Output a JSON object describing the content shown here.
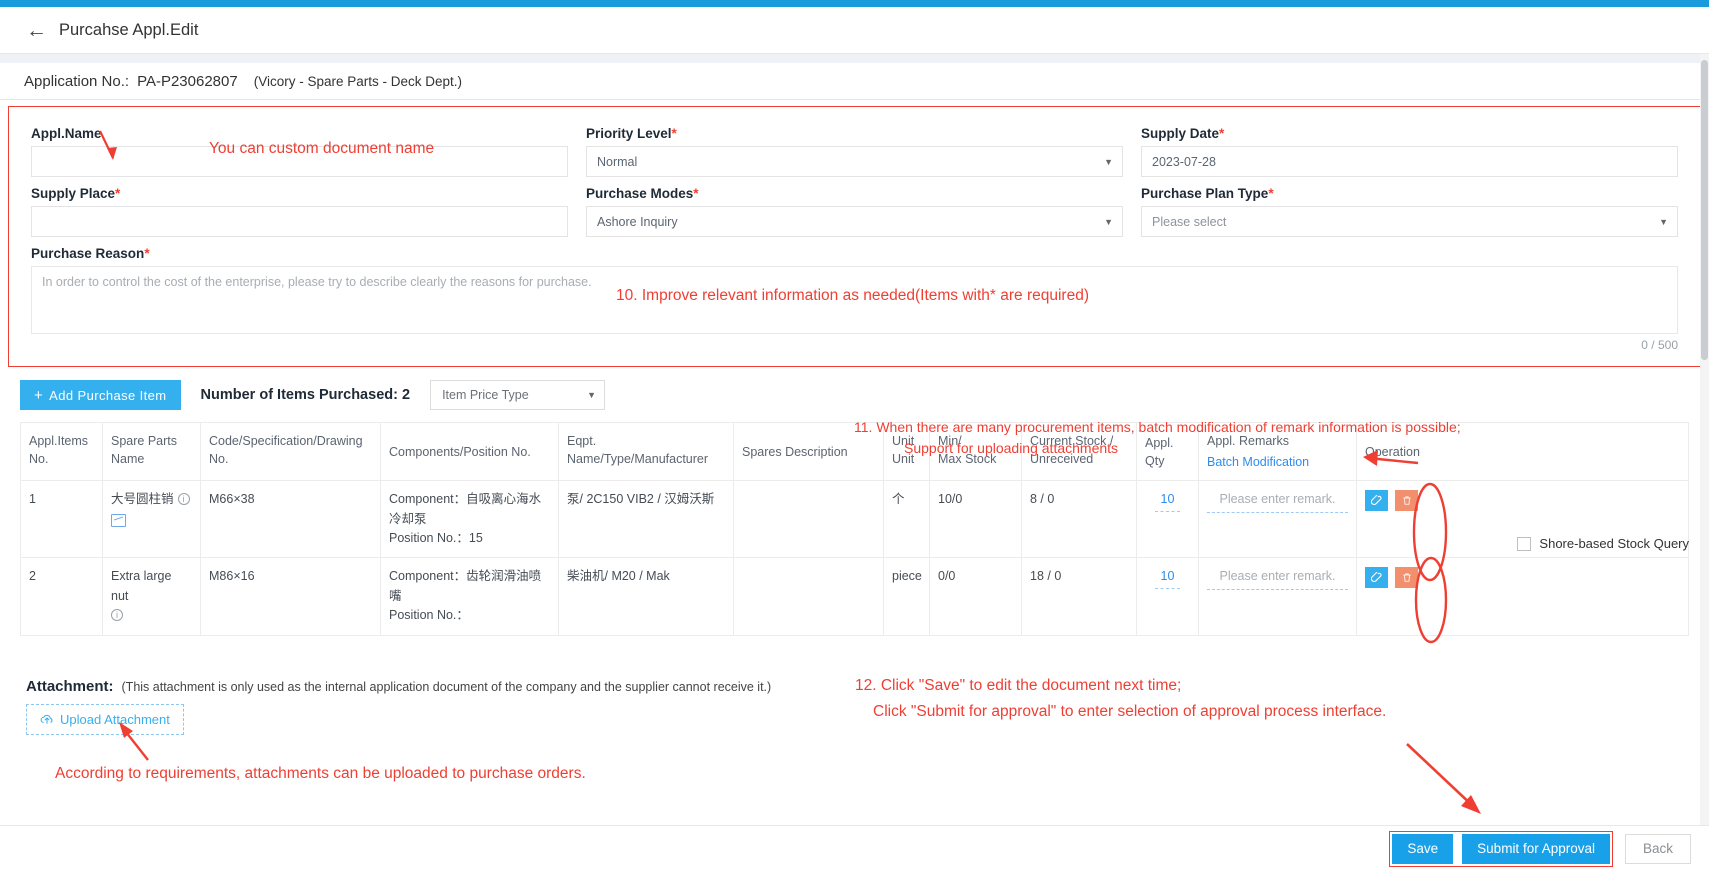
{
  "header": {
    "back_icon": "arrow-left-icon",
    "title": "Purcahse Appl.Edit",
    "application_no_label": "Application No.:",
    "application_no_value": "PA-P23062807",
    "application_sub": "(Vicory - Spare Parts - Deck Dept.)"
  },
  "form": {
    "appl_name": {
      "label": "Appl.Name",
      "required": false,
      "value": "",
      "placeholder": ""
    },
    "priority_level": {
      "label": "Priority Level",
      "required": true,
      "value": "Normal"
    },
    "supply_date": {
      "label": "Supply Date",
      "required": true,
      "value": "2023-07-28"
    },
    "supply_place": {
      "label": "Supply Place",
      "required": true,
      "value": "",
      "placeholder": ""
    },
    "purchase_modes": {
      "label": "Purchase Modes",
      "required": true,
      "value": "Ashore Inquiry"
    },
    "purchase_plan_type": {
      "label": "Purchase Plan Type",
      "required": true,
      "value": "Please select"
    },
    "purchase_reason": {
      "label": "Purchase Reason",
      "required": true,
      "value": "",
      "placeholder": "In order to control the cost of the enterprise, please try to describe clearly the reasons for purchase.",
      "counter": "0 / 500"
    }
  },
  "toolbar": {
    "add_item_label": "Add  Purchase  Item",
    "add_item_plus": "+",
    "items_count_label": "Number of Items Purchased:",
    "items_count_value": "2",
    "price_type_placeholder": "Item Price Type",
    "stock_query_label": "Shore-based Stock Query",
    "stock_query_checked": false
  },
  "table": {
    "columns": [
      "Appl.Items No.",
      "Spare Parts Name",
      "Code/Specification/Drawing No.",
      "Components/Position No.",
      "Eqpt. Name/Type/Manufacturer",
      "Spares Description",
      "Unit Unit",
      "Min/ Max Stock",
      "Current Stock / Unreceived",
      "Appl. Qty",
      "Appl. Remarks",
      "Operation"
    ],
    "columns_lines": {
      "c0a": "Appl.Items",
      "c0b": "No.",
      "c1a": "Spare Parts",
      "c1b": "Name",
      "c2a": "Code/Specification/Drawing",
      "c2b": "No.",
      "c3a": "Components/Position No.",
      "c4a": "Eqpt.",
      "c4b": "Name/Type/Manufacturer",
      "c5a": "Spares Description",
      "c6a": "Unit",
      "c6b": "Unit",
      "c7a": "Min/",
      "c7b": "Max Stock",
      "c8a": "Current Stock /",
      "c8b": "Unreceived",
      "c9a": "Appl. Qty",
      "c10a": "Appl. Remarks",
      "c10b": "Batch Modification",
      "c11a": "Operation"
    },
    "rows": [
      {
        "no": "1",
        "name": "大号圆柱销",
        "code": "M66×38",
        "component_label": "Component：",
        "component_value": "自吸离心海水冷却泵",
        "position_label": "Position No.：",
        "position_value": "15",
        "eqpt": "泵/ 2C150 VIB2 / 汉姆沃斯",
        "description": "",
        "unit": "个",
        "min_max": "10/0",
        "current_stock": "8 / 0",
        "qty": "10",
        "remark_placeholder": "Please enter remark.",
        "has_image": true
      },
      {
        "no": "2",
        "name": "Extra large nut",
        "code": "M86×16",
        "component_label": "Component：",
        "component_value": "齿轮润滑油喷嘴",
        "position_label": "Position No.：",
        "position_value": "",
        "eqpt": "柴油机/ M20 / Mak",
        "description": "",
        "unit": "piece",
        "min_max": "0/0",
        "current_stock": "18 / 0",
        "qty": "10",
        "remark_placeholder": "Please enter remark.",
        "has_image": false
      }
    ]
  },
  "attachment": {
    "label": "Attachment:",
    "note": "(This attachment is only used as the internal application document of the company and the supplier cannot receive it.)",
    "upload_label": "Upload Attachment",
    "upload_icon": "cloud-upload-icon"
  },
  "footer": {
    "save_label": "Save",
    "submit_label": "Submit for Approval",
    "back_label": "Back"
  },
  "annotations": {
    "a": "You can custom document name",
    "b": "10. Improve relevant information as needed(Items with* are required)",
    "c": "11. When there are many procurement items, batch modification of remark information is possible;",
    "d": "Support for uploading attachments",
    "e": "12. Click \"Save\" to edit the document next time;",
    "f": "Click \"Submit for approval\" to enter selection of approval process interface.",
    "g": "According to requirements, attachments can be uploaded to purchase orders."
  },
  "colors": {
    "accent": "#35b0ef",
    "annotation": "#ef3f33",
    "link": "#2d8cf0",
    "delete": "#f2906e"
  }
}
